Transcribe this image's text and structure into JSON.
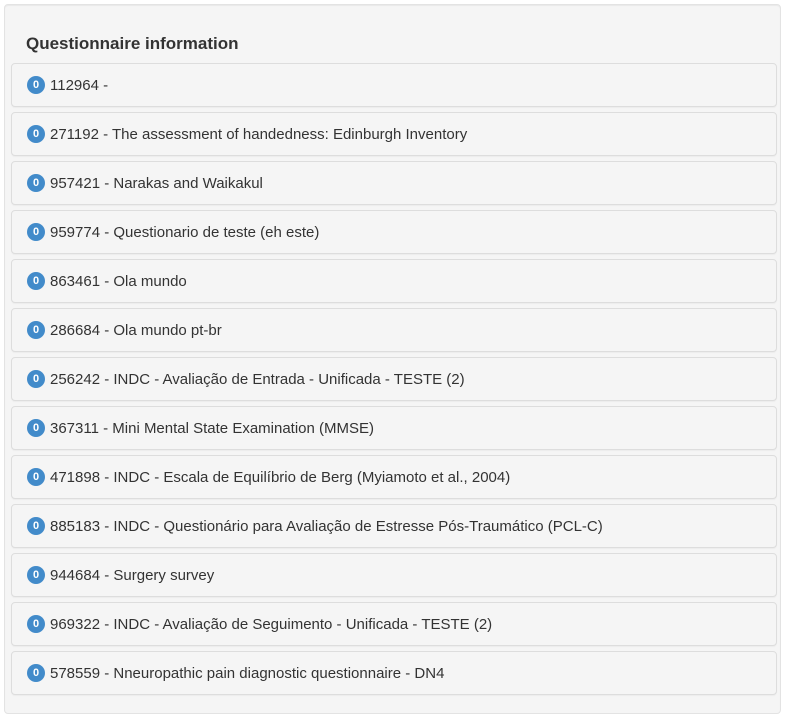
{
  "panel": {
    "title": "Questionnaire information",
    "items": [
      {
        "count": "0",
        "label": "112964 -"
      },
      {
        "count": "0",
        "label": "271192 - The assessment of handedness: Edinburgh Inventory"
      },
      {
        "count": "0",
        "label": "957421 - Narakas and Waikakul"
      },
      {
        "count": "0",
        "label": "959774 - Questionario de teste (eh este)"
      },
      {
        "count": "0",
        "label": "863461 - Ola mundo"
      },
      {
        "count": "0",
        "label": "286684 - Ola mundo pt-br"
      },
      {
        "count": "0",
        "label": "256242 - INDC - Avaliação de Entrada - Unificada - TESTE (2)"
      },
      {
        "count": "0",
        "label": "367311 - Mini Mental State Examination (MMSE)"
      },
      {
        "count": "0",
        "label": "471898 - INDC - Escala de Equilíbrio de Berg (Myiamoto et al., 2004)"
      },
      {
        "count": "0",
        "label": "885183 - INDC - Questionário para Avaliação de Estresse Pós-Traumático (PCL-C)"
      },
      {
        "count": "0",
        "label": "944684 - Surgery survey"
      },
      {
        "count": "0",
        "label": "969322 - INDC - Avaliação de Seguimento - Unificada - TESTE (2)"
      },
      {
        "count": "0",
        "label": "578559 - Nneuropathic pain diagnostic questionnaire - DN4"
      }
    ]
  },
  "colors": {
    "badge": "#428bca",
    "panel_background": "#f5f5f5",
    "text": "#333333"
  }
}
